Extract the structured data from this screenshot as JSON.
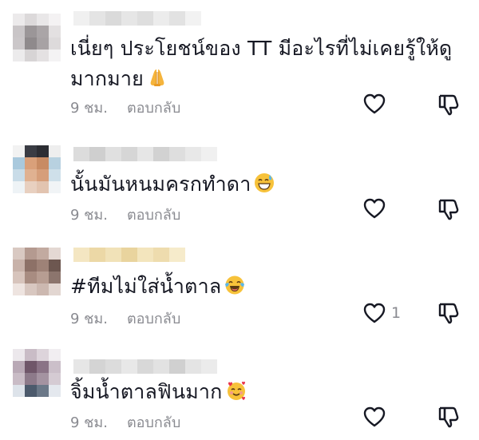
{
  "comments": [
    {
      "text_line1": "เนี่ยๆ ประโยชน์ของ TT มีอะไรที่ไม่เคยรู้ให้ดู",
      "text_line2": "มากมาย",
      "emoji": "folded-hands-emoji",
      "time": "9 ชม.",
      "reply_label": "ตอบกลับ",
      "like_count": ""
    },
    {
      "text_line1": "นั้นมันหนมครกทำดา",
      "emoji": "grinning-sweat-emoji",
      "time": "9 ชม.",
      "reply_label": "ตอบกลับ",
      "like_count": ""
    },
    {
      "text_line1": "#ทีมไม่ใส่น้ำตาล",
      "emoji": "tears-of-joy-emoji",
      "time": "9 ชม.",
      "reply_label": "ตอบกลับ",
      "like_count": "1"
    },
    {
      "text_line1": "จิ้มน้ำตาลฟินมาก",
      "emoji": "smiling-hearts-emoji",
      "time": "9 ชม.",
      "reply_label": "ตอบกลับ",
      "like_count": ""
    }
  ],
  "icons": {
    "like": "heart-outline-icon",
    "dislike": "thumbs-down-outline-icon"
  },
  "colors": {
    "text": "#161823",
    "meta": "#8a8b91",
    "icon": "#161823"
  }
}
